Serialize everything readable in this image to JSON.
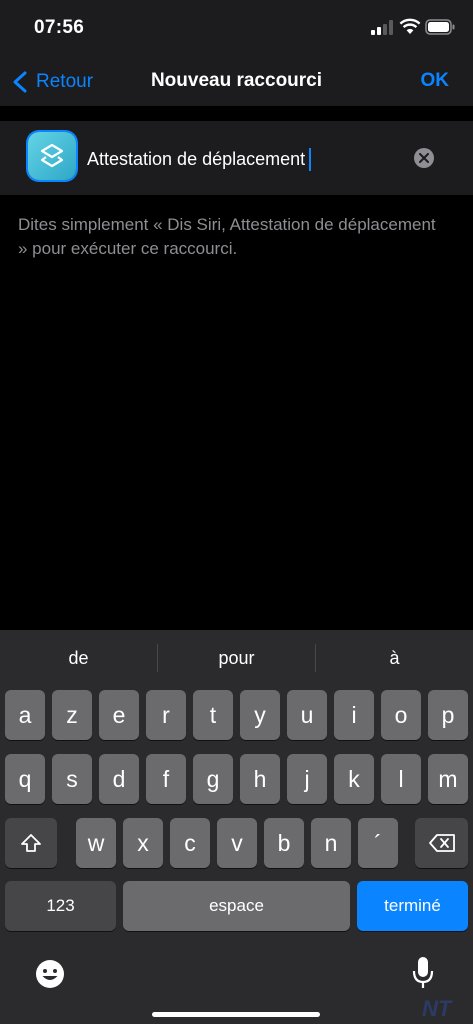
{
  "status_bar": {
    "time": "07:56"
  },
  "nav": {
    "back_label": "Retour",
    "title": "Nouveau raccourci",
    "ok_label": "OK"
  },
  "shortcut": {
    "name": "Attestation de déplacement"
  },
  "hint": "Dites simplement « Dis Siri, Attestation de déplacement  » pour exécuter ce raccourci.",
  "keyboard": {
    "suggestions": [
      "de",
      "pour",
      "à"
    ],
    "row1": [
      "a",
      "z",
      "e",
      "r",
      "t",
      "y",
      "u",
      "i",
      "o",
      "p"
    ],
    "row2": [
      "q",
      "s",
      "d",
      "f",
      "g",
      "h",
      "j",
      "k",
      "l",
      "m"
    ],
    "row3": [
      "w",
      "x",
      "c",
      "v",
      "b",
      "n",
      "´"
    ],
    "numbers_label": "123",
    "space_label": "espace",
    "done_label": "terminé"
  },
  "watermark": "NT",
  "colors": {
    "accent": "#0a84ff",
    "background": "#000000",
    "panel": "#1c1c1e",
    "keyboard": "#2b2b2d"
  }
}
